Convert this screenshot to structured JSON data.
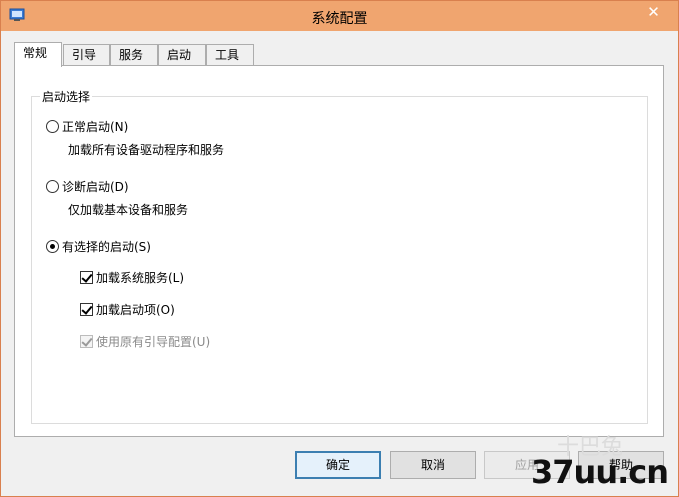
{
  "window": {
    "title": "系统配置",
    "close_glyph": "✕"
  },
  "tabs": [
    {
      "label": "常规",
      "active": true
    },
    {
      "label": "引导",
      "active": false
    },
    {
      "label": "服务",
      "active": false
    },
    {
      "label": "启动",
      "active": false
    },
    {
      "label": "工具",
      "active": false
    }
  ],
  "general": {
    "group_title": "启动选择",
    "normal": {
      "label": "正常启动(N)",
      "desc": "加载所有设备驱动程序和服务",
      "selected": false
    },
    "diagnostic": {
      "label": "诊断启动(D)",
      "desc": "仅加载基本设备和服务",
      "selected": false
    },
    "selective": {
      "label": "有选择的启动(S)",
      "selected": true,
      "options": [
        {
          "label": "加载系统服务(L)",
          "checked": true,
          "enabled": true
        },
        {
          "label": "加载启动项(O)",
          "checked": true,
          "enabled": true
        },
        {
          "label": "使用原有引导配置(U)",
          "checked": true,
          "enabled": false
        }
      ]
    }
  },
  "buttons": {
    "ok": "确定",
    "cancel": "取消",
    "apply": "应用",
    "help": "帮助"
  },
  "watermark": {
    "text": "37uu.cn",
    "faint": "十巴兔"
  },
  "colors": {
    "titlebar": "#f0a56f",
    "border": "#d9804e"
  }
}
